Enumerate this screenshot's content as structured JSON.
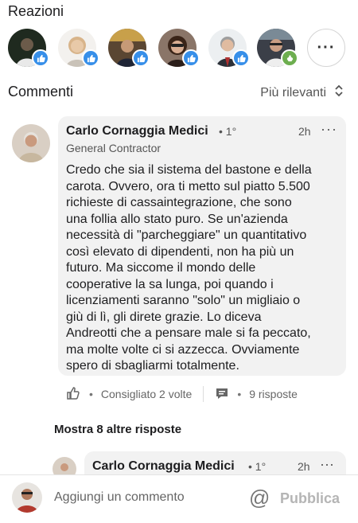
{
  "reactions": {
    "title": "Reazioni",
    "reactors": [
      {
        "badge": "like",
        "skin": "#6b5b4a",
        "bg": "#1f2a1f"
      },
      {
        "badge": "like",
        "skin": "#e8c9a8",
        "bg": "#f3f1ee"
      },
      {
        "badge": "like",
        "skin": "#c69a77",
        "bg": "#5a4632"
      },
      {
        "badge": "like",
        "skin": "#d8ad92",
        "bg": "#8a7568"
      },
      {
        "badge": "like",
        "skin": "#e0bba0",
        "bg": "#eceff1"
      },
      {
        "badge": "support",
        "skin": "#c99e84",
        "bg": "#3b3f48"
      }
    ],
    "more_label": "···"
  },
  "comments": {
    "title": "Commenti",
    "sort_label": "Più rilevanti"
  },
  "comment": {
    "author": "Carlo Cornaggia Medici",
    "degree": "• 1°",
    "time": "2h",
    "more": "···",
    "headline": "General Contractor",
    "lines": [
      "Credo che sia il sistema del bastone e della",
      "carota. Ovvero, ora ti metto sul piatto 5.500",
      "richieste di cassaintegrazione, che sono",
      "una follia allo stato puro. Se un'azienda",
      "necessità di \"parcheggiare\" un quantitativo",
      "così elevato di dipendenti, non ha più un",
      "futuro. Ma siccome il mondo delle",
      "cooperative la sa lunga, poi quando i",
      "licenziamenti saranno \"solo\" un migliaio o",
      "giù di lì, gli direte grazie. Lo diceva",
      "Andreotti che a pensare male si fa peccato,",
      "ma molte volte ci si azzecca. Ovviamente",
      "spero di sbagliarmi totalmente."
    ],
    "reactions_count": "Consigliato 2 volte",
    "replies_count": "9 risposte",
    "separator": "•"
  },
  "show_more": "Mostra 8 altre risposte",
  "reply": {
    "author": "Carlo Cornaggia Medici",
    "degree": "• 1°",
    "time": "2h",
    "more": "···"
  },
  "composer": {
    "placeholder": "Aggiungi un commento",
    "mention_icon": "@",
    "publish": "Pubblica"
  },
  "colors": {
    "like_blue": "#378fe9",
    "support_green": "#6dae4f",
    "bubble": "#f2f2f2"
  }
}
